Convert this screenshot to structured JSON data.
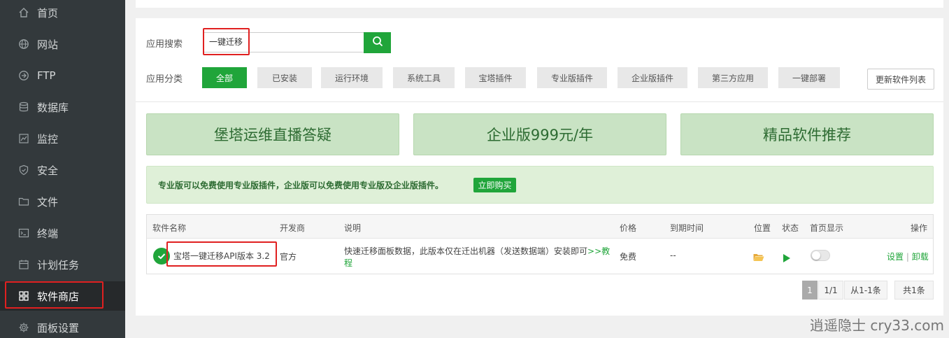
{
  "sidebar": {
    "items": [
      {
        "label": "首页",
        "icon": "home-icon"
      },
      {
        "label": "网站",
        "icon": "globe-icon"
      },
      {
        "label": "FTP",
        "icon": "ftp-icon"
      },
      {
        "label": "数据库",
        "icon": "database-icon"
      },
      {
        "label": "监控",
        "icon": "monitor-icon"
      },
      {
        "label": "安全",
        "icon": "shield-icon"
      },
      {
        "label": "文件",
        "icon": "folder-icon"
      },
      {
        "label": "终端",
        "icon": "terminal-icon"
      },
      {
        "label": "计划任务",
        "icon": "calendar-icon"
      },
      {
        "label": "软件商店",
        "icon": "grid-icon",
        "active": true
      },
      {
        "label": "面板设置",
        "icon": "gear-icon"
      }
    ]
  },
  "search": {
    "label": "应用搜索",
    "value": "一键迁移"
  },
  "categories": {
    "label": "应用分类",
    "items": [
      "全部",
      "已安装",
      "运行环境",
      "系统工具",
      "宝塔插件",
      "专业版插件",
      "企业版插件",
      "第三方应用",
      "一键部署"
    ],
    "active": "全部",
    "refresh_label": "更新软件列表"
  },
  "banners": [
    "堡塔运维直播答疑",
    "企业版999元/年",
    "精品软件推荐"
  ],
  "notice": {
    "text": "专业版可以免费使用专业版插件，企业版可以免费使用专业版及企业版插件。",
    "button": "立即购买"
  },
  "table": {
    "headers": {
      "name": "软件名称",
      "developer": "开发商",
      "description": "说明",
      "price": "价格",
      "expire": "到期时间",
      "location": "位置",
      "status": "状态",
      "homepage": "首页显示",
      "actions": "操作"
    },
    "rows": [
      {
        "name": "宝塔一键迁移API版本 3.2",
        "developer": "官方",
        "description_1": "快速迁移面板数据，此版本仅在迁出机器（发送数据端）安装即可",
        "description_link_1": ">>教",
        "description_link_2": "程",
        "price": "免费",
        "expire": "--",
        "homepage_enabled": false,
        "action_settings": "设置",
        "action_separator": "|",
        "action_uninstall": "卸载"
      }
    ]
  },
  "pagination": {
    "current": "1",
    "pages": "1/1",
    "range": "从1-1条",
    "total": "共1条"
  },
  "watermark": "逍遥隐士 cry33.com",
  "colors": {
    "accent": "#20a53a",
    "sidebar_bg": "#33393c",
    "highlight_box": "#e02020",
    "banner_bg": "#c9e3c4"
  }
}
